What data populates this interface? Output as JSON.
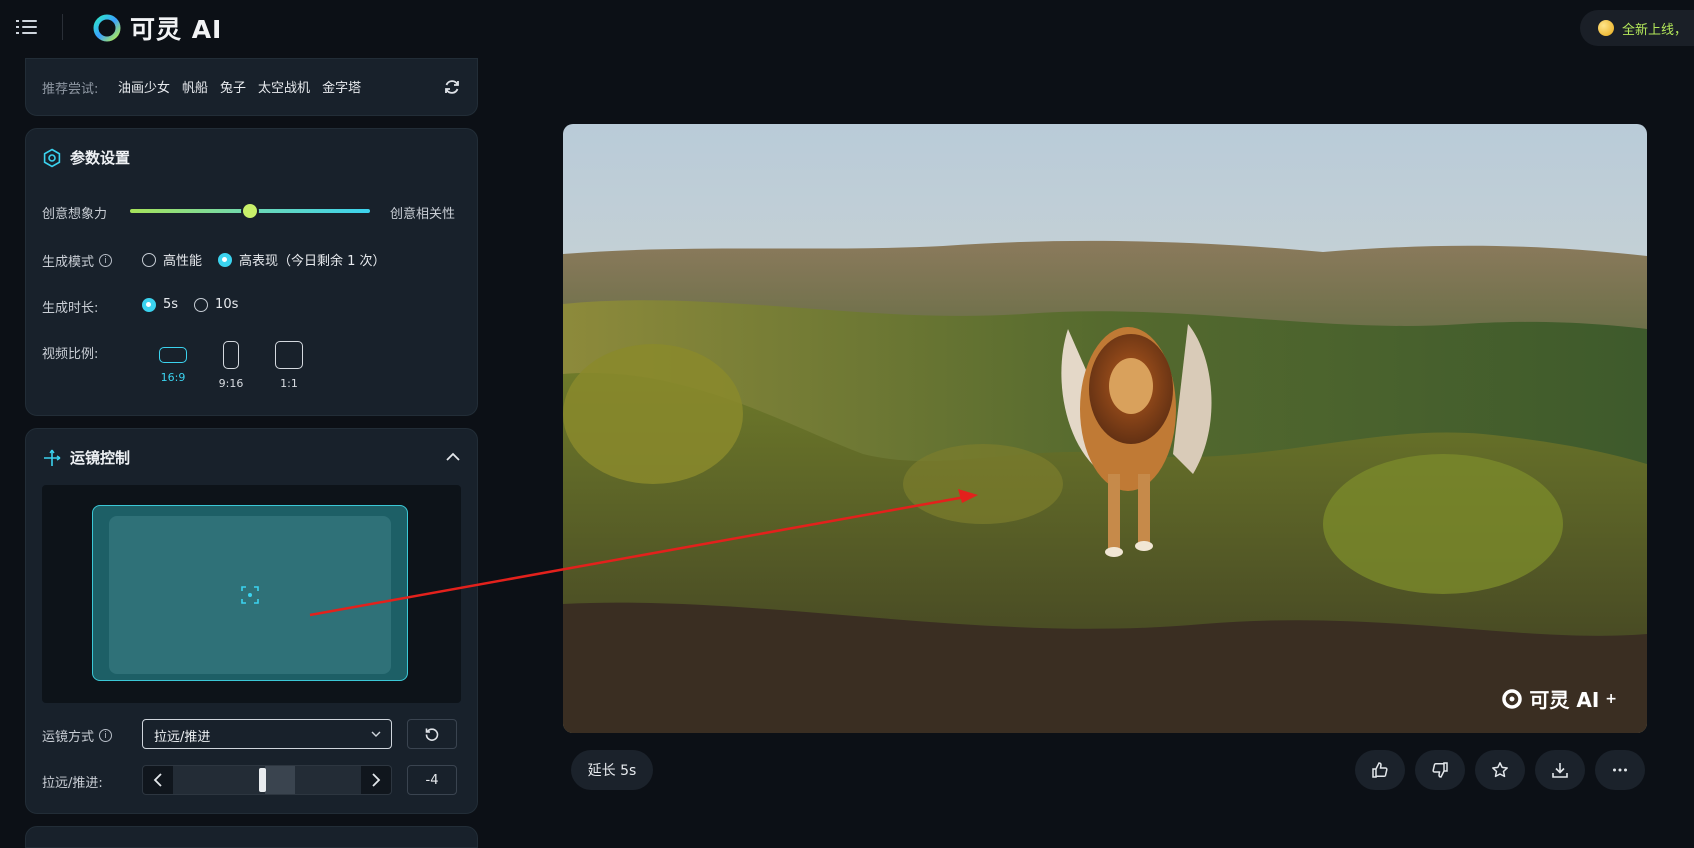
{
  "app": {
    "logo_text": "可灵 AI",
    "promo_text": "全新上线，"
  },
  "suggest": {
    "label": "推荐尝试:",
    "items": [
      "油画少女",
      "帆船",
      "兔子",
      "太空战机",
      "金字塔"
    ]
  },
  "params": {
    "title": "参数设置",
    "creativity": {
      "left_label": "创意想象力",
      "right_label": "创意相关性",
      "value": 0.5
    },
    "mode": {
      "label": "生成模式",
      "options": [
        "高性能",
        "高表现（今日剩余 1 次）"
      ],
      "selected": 1
    },
    "duration": {
      "label": "生成时长:",
      "options": [
        "5s",
        "10s"
      ],
      "selected": 0
    },
    "ratio": {
      "label": "视频比例:",
      "options": [
        "16:9",
        "9:16",
        "1:1"
      ],
      "selected": 0
    }
  },
  "camera": {
    "title": "运镜控制",
    "method_label": "运镜方式",
    "method_value": "拉远/推进",
    "zoom_label": "拉远/推进:",
    "zoom_value": "-4"
  },
  "video": {
    "watermark": "可灵 AI",
    "watermark_sup": "+"
  },
  "actions": {
    "extend_label": "延长 5s"
  },
  "colors": {
    "accent": "#3bd3ef",
    "slider_start": "#a6e35a",
    "annotation_arrow": "#e3211c"
  }
}
